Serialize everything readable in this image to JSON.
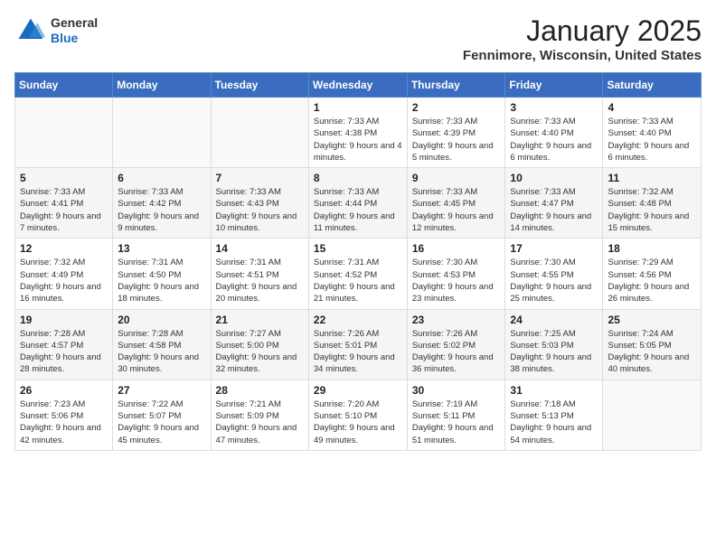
{
  "header": {
    "logo": {
      "general": "General",
      "blue": "Blue"
    },
    "title": "January 2025",
    "location": "Fennimore, Wisconsin, United States"
  },
  "calendar": {
    "days_of_week": [
      "Sunday",
      "Monday",
      "Tuesday",
      "Wednesday",
      "Thursday",
      "Friday",
      "Saturday"
    ],
    "weeks": [
      [
        {
          "day": "",
          "info": ""
        },
        {
          "day": "",
          "info": ""
        },
        {
          "day": "",
          "info": ""
        },
        {
          "day": "1",
          "info": "Sunrise: 7:33 AM\nSunset: 4:38 PM\nDaylight: 9 hours and 4 minutes."
        },
        {
          "day": "2",
          "info": "Sunrise: 7:33 AM\nSunset: 4:39 PM\nDaylight: 9 hours and 5 minutes."
        },
        {
          "day": "3",
          "info": "Sunrise: 7:33 AM\nSunset: 4:40 PM\nDaylight: 9 hours and 6 minutes."
        },
        {
          "day": "4",
          "info": "Sunrise: 7:33 AM\nSunset: 4:40 PM\nDaylight: 9 hours and 6 minutes."
        }
      ],
      [
        {
          "day": "5",
          "info": "Sunrise: 7:33 AM\nSunset: 4:41 PM\nDaylight: 9 hours and 7 minutes."
        },
        {
          "day": "6",
          "info": "Sunrise: 7:33 AM\nSunset: 4:42 PM\nDaylight: 9 hours and 9 minutes."
        },
        {
          "day": "7",
          "info": "Sunrise: 7:33 AM\nSunset: 4:43 PM\nDaylight: 9 hours and 10 minutes."
        },
        {
          "day": "8",
          "info": "Sunrise: 7:33 AM\nSunset: 4:44 PM\nDaylight: 9 hours and 11 minutes."
        },
        {
          "day": "9",
          "info": "Sunrise: 7:33 AM\nSunset: 4:45 PM\nDaylight: 9 hours and 12 minutes."
        },
        {
          "day": "10",
          "info": "Sunrise: 7:33 AM\nSunset: 4:47 PM\nDaylight: 9 hours and 14 minutes."
        },
        {
          "day": "11",
          "info": "Sunrise: 7:32 AM\nSunset: 4:48 PM\nDaylight: 9 hours and 15 minutes."
        }
      ],
      [
        {
          "day": "12",
          "info": "Sunrise: 7:32 AM\nSunset: 4:49 PM\nDaylight: 9 hours and 16 minutes."
        },
        {
          "day": "13",
          "info": "Sunrise: 7:31 AM\nSunset: 4:50 PM\nDaylight: 9 hours and 18 minutes."
        },
        {
          "day": "14",
          "info": "Sunrise: 7:31 AM\nSunset: 4:51 PM\nDaylight: 9 hours and 20 minutes."
        },
        {
          "day": "15",
          "info": "Sunrise: 7:31 AM\nSunset: 4:52 PM\nDaylight: 9 hours and 21 minutes."
        },
        {
          "day": "16",
          "info": "Sunrise: 7:30 AM\nSunset: 4:53 PM\nDaylight: 9 hours and 23 minutes."
        },
        {
          "day": "17",
          "info": "Sunrise: 7:30 AM\nSunset: 4:55 PM\nDaylight: 9 hours and 25 minutes."
        },
        {
          "day": "18",
          "info": "Sunrise: 7:29 AM\nSunset: 4:56 PM\nDaylight: 9 hours and 26 minutes."
        }
      ],
      [
        {
          "day": "19",
          "info": "Sunrise: 7:28 AM\nSunset: 4:57 PM\nDaylight: 9 hours and 28 minutes."
        },
        {
          "day": "20",
          "info": "Sunrise: 7:28 AM\nSunset: 4:58 PM\nDaylight: 9 hours and 30 minutes."
        },
        {
          "day": "21",
          "info": "Sunrise: 7:27 AM\nSunset: 5:00 PM\nDaylight: 9 hours and 32 minutes."
        },
        {
          "day": "22",
          "info": "Sunrise: 7:26 AM\nSunset: 5:01 PM\nDaylight: 9 hours and 34 minutes."
        },
        {
          "day": "23",
          "info": "Sunrise: 7:26 AM\nSunset: 5:02 PM\nDaylight: 9 hours and 36 minutes."
        },
        {
          "day": "24",
          "info": "Sunrise: 7:25 AM\nSunset: 5:03 PM\nDaylight: 9 hours and 38 minutes."
        },
        {
          "day": "25",
          "info": "Sunrise: 7:24 AM\nSunset: 5:05 PM\nDaylight: 9 hours and 40 minutes."
        }
      ],
      [
        {
          "day": "26",
          "info": "Sunrise: 7:23 AM\nSunset: 5:06 PM\nDaylight: 9 hours and 42 minutes."
        },
        {
          "day": "27",
          "info": "Sunrise: 7:22 AM\nSunset: 5:07 PM\nDaylight: 9 hours and 45 minutes."
        },
        {
          "day": "28",
          "info": "Sunrise: 7:21 AM\nSunset: 5:09 PM\nDaylight: 9 hours and 47 minutes."
        },
        {
          "day": "29",
          "info": "Sunrise: 7:20 AM\nSunset: 5:10 PM\nDaylight: 9 hours and 49 minutes."
        },
        {
          "day": "30",
          "info": "Sunrise: 7:19 AM\nSunset: 5:11 PM\nDaylight: 9 hours and 51 minutes."
        },
        {
          "day": "31",
          "info": "Sunrise: 7:18 AM\nSunset: 5:13 PM\nDaylight: 9 hours and 54 minutes."
        },
        {
          "day": "",
          "info": ""
        }
      ]
    ]
  }
}
